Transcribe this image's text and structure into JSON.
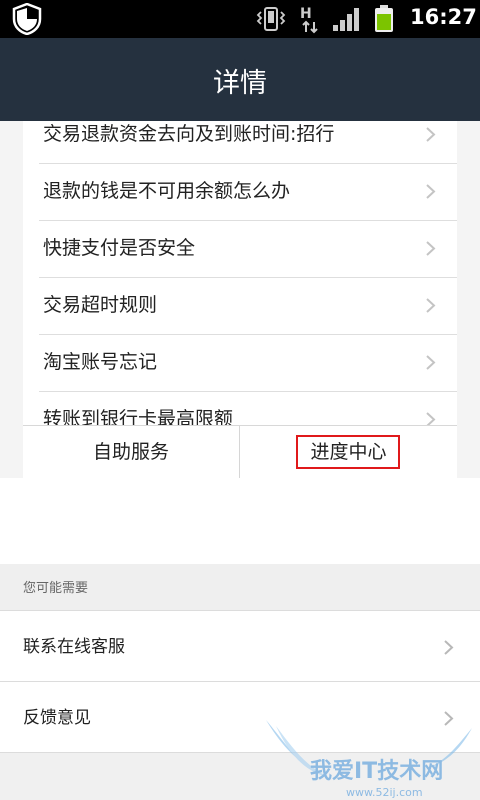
{
  "status_bar": {
    "time": "16:27",
    "network": "H",
    "icons": [
      "shield-icon",
      "vibrate-icon",
      "hplus-network-icon",
      "signal-icon",
      "battery-icon"
    ],
    "battery_color": "#7cc400"
  },
  "header": {
    "title": "详情",
    "background": "#25313f"
  },
  "faq": {
    "items": [
      {
        "label": "交易退款资金去向及到账时间:招行"
      },
      {
        "label": "退款的钱是不可用余额怎么办"
      },
      {
        "label": "快捷支付是否安全"
      },
      {
        "label": "交易超时规则"
      },
      {
        "label": "淘宝账号忘记"
      },
      {
        "label": "转账到银行卡最高限额"
      }
    ]
  },
  "tabs": {
    "items": [
      {
        "label": "自助服务"
      },
      {
        "label": "进度中心",
        "highlighted": true
      }
    ],
    "highlight_color": "#e0191b"
  },
  "suggest": {
    "header": "您可能需要",
    "items": [
      {
        "label": "联系在线客服"
      },
      {
        "label": "反馈意见"
      }
    ]
  },
  "watermark": {
    "text": "我爱IT技术网",
    "url": "www.52ij.com"
  }
}
